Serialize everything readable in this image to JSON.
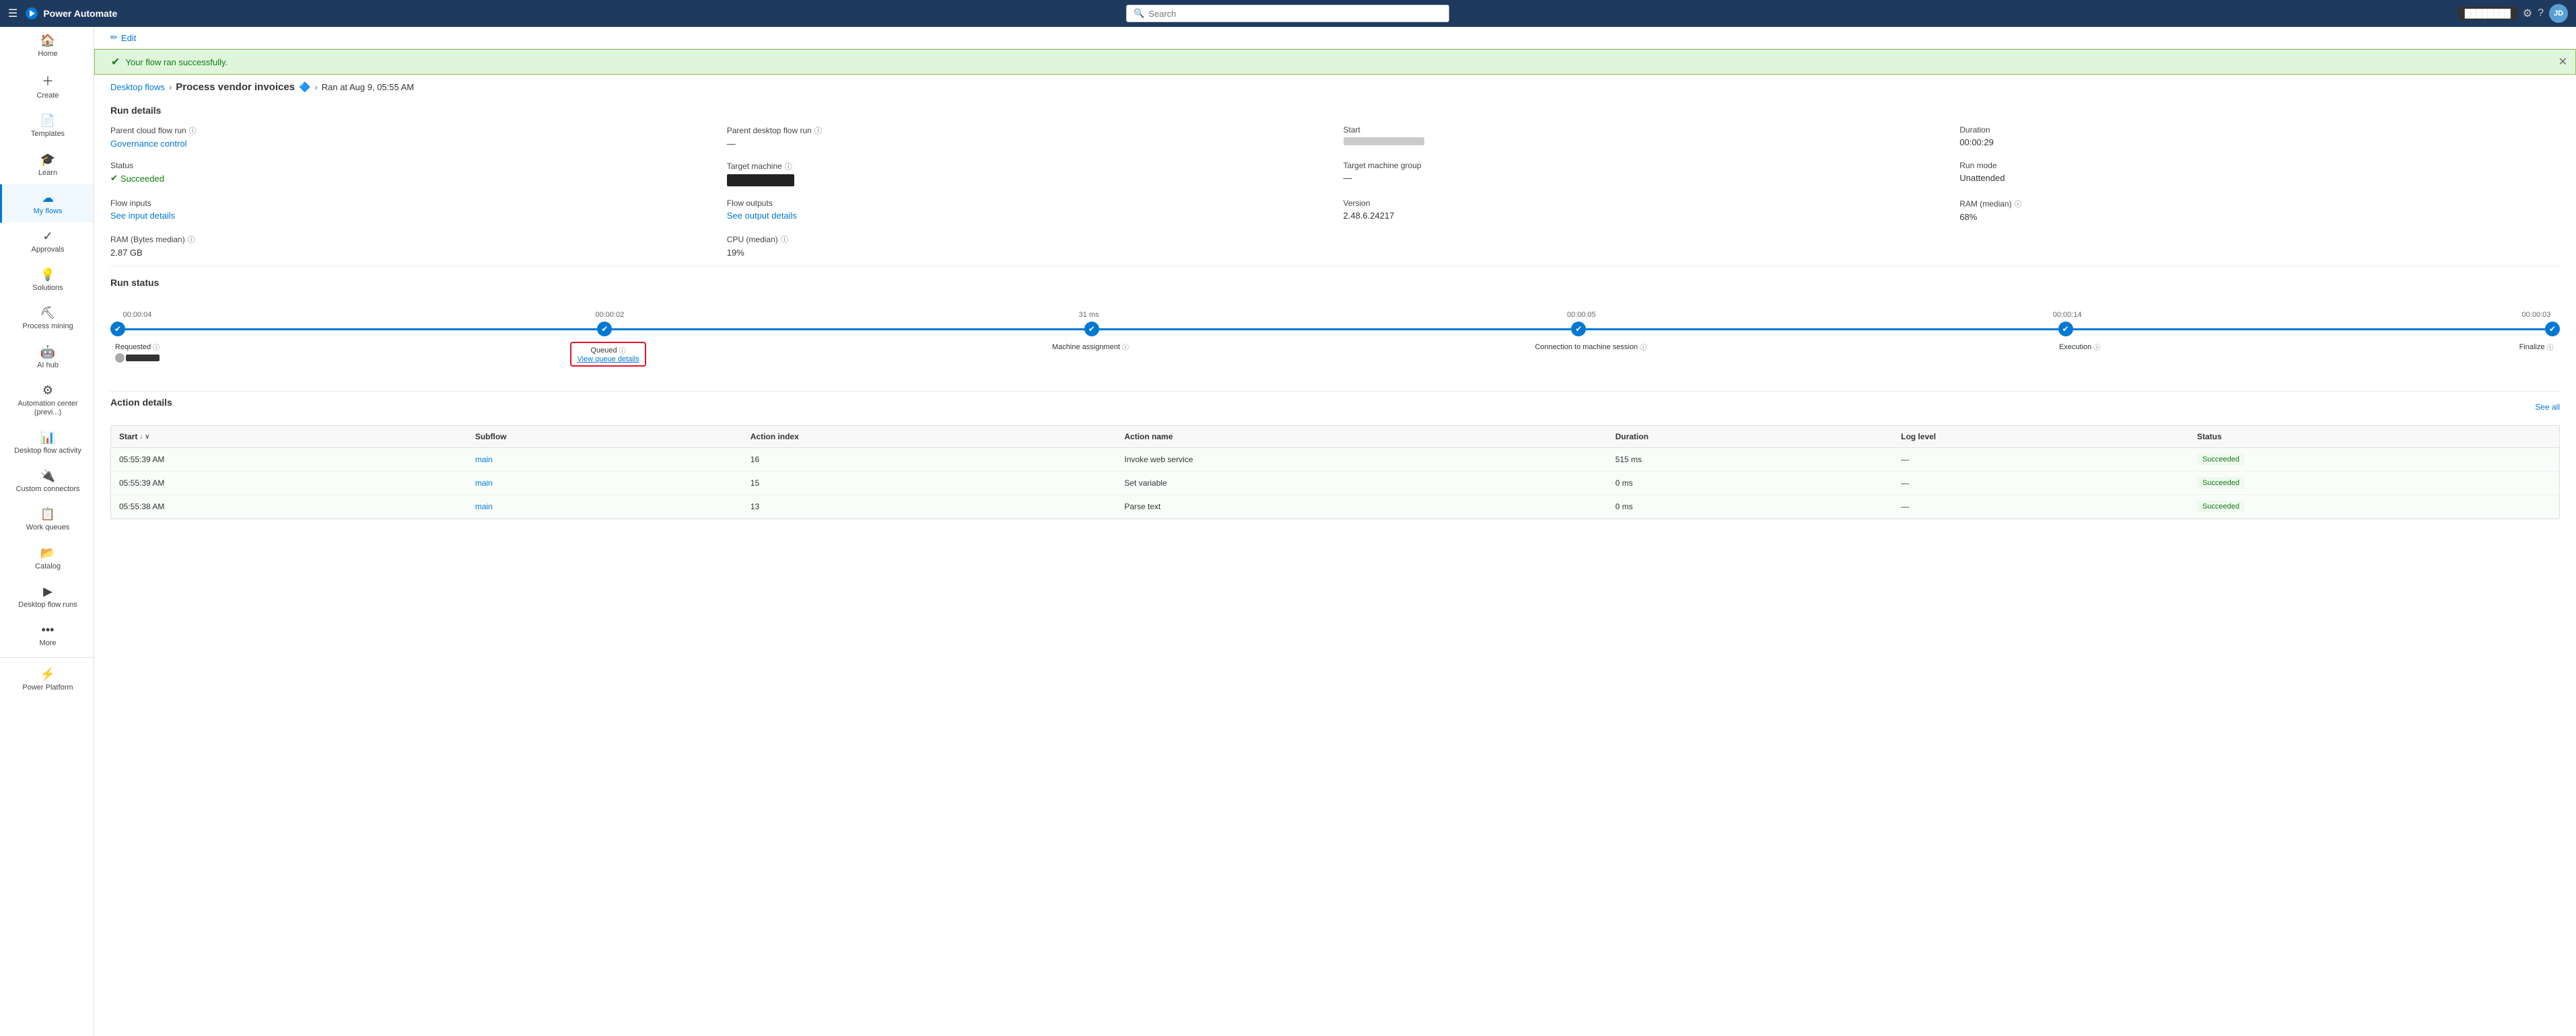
{
  "app": {
    "brand": "Power Automate",
    "search_placeholder": "Search"
  },
  "topbar": {
    "right_btn": "████████",
    "avatar_initials": "JD"
  },
  "sidebar": {
    "items": [
      {
        "id": "home",
        "label": "Home",
        "icon": "🏠"
      },
      {
        "id": "create",
        "label": "Create",
        "icon": "+"
      },
      {
        "id": "templates",
        "label": "Templates",
        "icon": "📄"
      },
      {
        "id": "learn",
        "label": "Learn",
        "icon": "🎓"
      },
      {
        "id": "my-flows",
        "label": "My flows",
        "icon": "☁",
        "active": true
      },
      {
        "id": "approvals",
        "label": "Approvals",
        "icon": "✓"
      },
      {
        "id": "solutions",
        "label": "Solutions",
        "icon": "💡"
      },
      {
        "id": "process-mining",
        "label": "Process mining",
        "icon": "⛏"
      },
      {
        "id": "ai-hub",
        "label": "AI hub",
        "icon": "🤖"
      },
      {
        "id": "automation-center",
        "label": "Automation center (previ...)",
        "icon": "⚙"
      },
      {
        "id": "desktop-flow-activity",
        "label": "Desktop flow activity",
        "icon": "📊"
      },
      {
        "id": "custom-connectors",
        "label": "Custom connectors",
        "icon": "🔌"
      },
      {
        "id": "work-queues",
        "label": "Work queues",
        "icon": "📋"
      },
      {
        "id": "catalog",
        "label": "Catalog",
        "icon": "📂"
      },
      {
        "id": "desktop-flow-runs",
        "label": "Desktop flow runs",
        "icon": "▶"
      },
      {
        "id": "more",
        "label": "More",
        "icon": "..."
      },
      {
        "id": "power-platform",
        "label": "Power Platform",
        "icon": "⚡"
      }
    ]
  },
  "edit_bar": {
    "edit_label": "Edit"
  },
  "success_banner": {
    "message": "Your flow ran successfully."
  },
  "breadcrumb": {
    "desktop_flows": "Desktop flows",
    "flow_name": "Process vendor invoices",
    "run_info": "Ran at Aug 9, 05:55 AM"
  },
  "run_details": {
    "section_title": "Run details",
    "parent_cloud_flow_run_label": "Parent cloud flow run",
    "parent_cloud_flow_run_value": "Governance control",
    "parent_desktop_flow_run_label": "Parent desktop flow run",
    "parent_desktop_flow_run_value": "—",
    "start_label": "Start",
    "start_value_blurred": true,
    "duration_label": "Duration",
    "duration_value": "00:00:29",
    "status_label": "Status",
    "status_value": "Succeeded",
    "target_machine_label": "Target machine",
    "target_machine_value_blacked": true,
    "target_machine_group_label": "Target machine group",
    "target_machine_group_value": "—",
    "run_mode_label": "Run mode",
    "run_mode_value": "Unattended",
    "flow_inputs_label": "Flow inputs",
    "flow_inputs_link": "See input details",
    "flow_outputs_label": "Flow outputs",
    "flow_outputs_link": "See output details",
    "version_label": "Version",
    "version_value": "2.48.6.24217",
    "ram_median_label": "RAM (median)",
    "ram_median_value": "68%",
    "ram_bytes_label": "RAM (Bytes median)",
    "ram_bytes_value": "2.87 GB",
    "cpu_label": "CPU (median)",
    "cpu_value": "19%"
  },
  "run_status": {
    "section_title": "Run status",
    "stages": [
      {
        "id": "requested",
        "label": "Requested",
        "time": "00:00:04",
        "has_info": true,
        "has_avatar": true
      },
      {
        "id": "queued",
        "label": "Queued",
        "time": "00:00:02",
        "has_info": true,
        "highlighted": true,
        "link": "View queue details"
      },
      {
        "id": "machine-assignment",
        "label": "Machine assignment",
        "time": "31 ms",
        "has_info": true
      },
      {
        "id": "connection",
        "label": "Connection to machine session",
        "time": "00:00:05",
        "has_info": true
      },
      {
        "id": "execution",
        "label": "Execution",
        "time": "00:00:14",
        "has_info": true
      },
      {
        "id": "finalize",
        "label": "Finalize",
        "time": "00:00:03",
        "has_info": true
      }
    ]
  },
  "action_details": {
    "section_title": "Action details",
    "see_all_label": "See all",
    "columns": [
      "Start",
      "Subflow",
      "Action index",
      "Action name",
      "Duration",
      "Log level",
      "Status"
    ],
    "rows": [
      {
        "start": "05:55:39 AM",
        "subflow": "main",
        "action_index": "16",
        "action_name": "Invoke web service",
        "duration": "515 ms",
        "log_level": "—",
        "status": "Succeeded"
      },
      {
        "start": "05:55:39 AM",
        "subflow": "main",
        "action_index": "15",
        "action_name": "Set variable",
        "duration": "0 ms",
        "log_level": "—",
        "status": "Succeeded"
      },
      {
        "start": "05:55:38 AM",
        "subflow": "main",
        "action_index": "13",
        "action_name": "Parse text",
        "duration": "0 ms",
        "log_level": "—",
        "status": "Succeeded"
      }
    ]
  }
}
